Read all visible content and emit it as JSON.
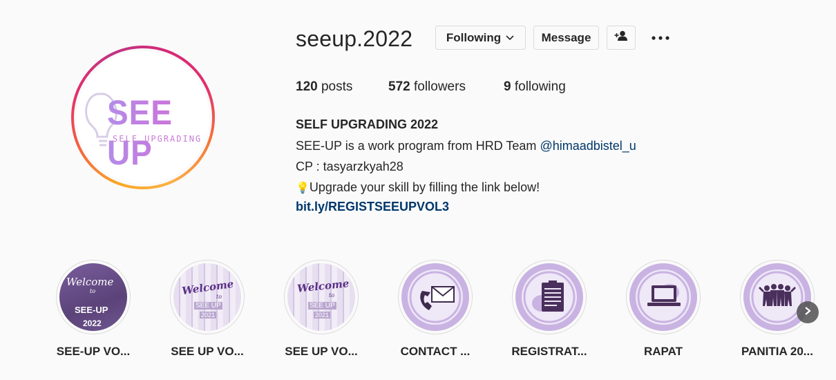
{
  "profile": {
    "username": "seeup.2022",
    "avatar_title": "SEE UP",
    "avatar_subtitle": "SELF UPGRADING",
    "buttons": {
      "following": "Following",
      "message": "Message"
    },
    "stats": {
      "posts_count": "120",
      "posts_label": "posts",
      "followers_count": "572",
      "followers_label": "followers",
      "following_count": "9",
      "following_label": "following"
    },
    "bio": {
      "name": "SELF UPGRADING 2022",
      "line1_text": "SEE-UP is a work program from HRD Team ",
      "line1_mention": "@himaadbistel_u",
      "line2": "CP : tasyarzkyah28",
      "line3_emoji": "💡",
      "line3_text": "Upgrade your skill by filling the link below!",
      "link": "bit.ly/REGISTSEEUPVOL3"
    }
  },
  "highlights": [
    {
      "label": "SEE-UP VO...",
      "thumb_lines": [
        "Welcome",
        "to",
        "SEE-UP",
        "2022"
      ]
    },
    {
      "label": "SEE UP VO...",
      "thumb_lines": [
        "Welcome",
        "to",
        "SEE UP",
        "2021"
      ]
    },
    {
      "label": "SEE UP VO...",
      "thumb_lines": [
        "Welcome",
        "to",
        "SEE UP",
        "2021"
      ]
    },
    {
      "label": "CONTACT ...",
      "thumb_icon": "phone-mail-icon"
    },
    {
      "label": "REGISTRAT...",
      "thumb_icon": "clipboard-icon"
    },
    {
      "label": "RAPAT",
      "thumb_icon": "laptop-icon"
    },
    {
      "label": "PANITIA 20...",
      "thumb_icon": "people-group-icon"
    }
  ],
  "colors": {
    "accent_purple": "#b58bd9",
    "dark_purple": "#4a2f5c",
    "link_blue": "#00376b"
  }
}
